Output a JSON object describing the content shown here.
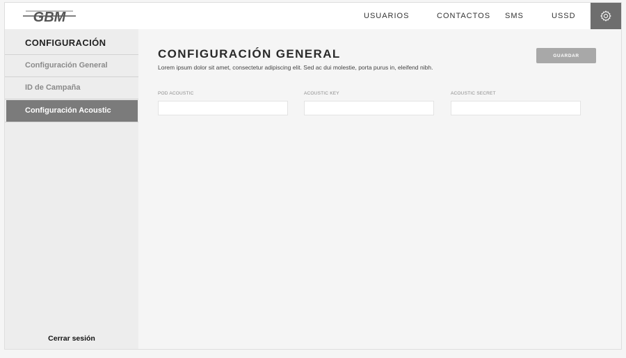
{
  "header": {
    "logo_text": "GBM",
    "nav": [
      "USUARIOS",
      "CONTACTOS",
      "SMS",
      "USSD"
    ],
    "settings_icon": "gear-icon"
  },
  "sidebar": {
    "title": "CONFIGURACIÓN",
    "items": [
      {
        "label": "Configuración General",
        "active": false
      },
      {
        "label": "ID de Campaña",
        "active": false
      },
      {
        "label": "Configuración Acoustic",
        "active": true
      }
    ],
    "logout_label": "Cerrar sesión"
  },
  "main": {
    "title": "CONFIGURACIÓN GENERAL",
    "description": "Lorem ipsum dolor sit amet, consectetur adipiscing elit. Sed ac dui molestie, porta purus in, eleifend nibh.",
    "save_label": "GUARDAR",
    "fields": [
      {
        "label": "POD ACOUSTIC",
        "value": "",
        "placeholder": ""
      },
      {
        "label": "ACOUSTIC KEY",
        "value": "",
        "placeholder": ""
      },
      {
        "label": "ACOUSTIC SECRET",
        "value": "",
        "placeholder": ""
      }
    ]
  },
  "colors": {
    "accent": "#7b7b7b",
    "button": "#a8a8a8",
    "sidebar_bg": "#ededed",
    "page_bg": "#f5f5f5"
  }
}
